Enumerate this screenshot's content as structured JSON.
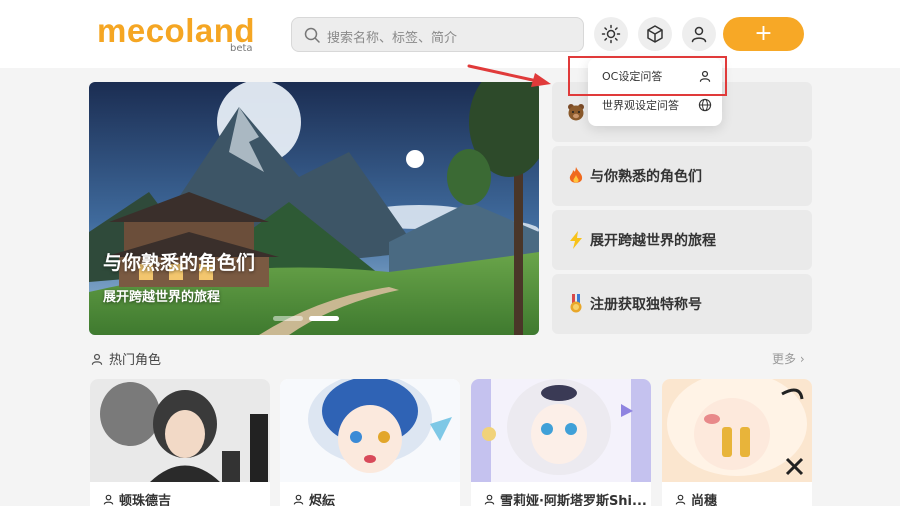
{
  "header": {
    "logo": "mecoland",
    "logo_badge": "beta",
    "search_placeholder": "搜索名称、标签、简介",
    "plus_label": "+"
  },
  "dropdown": {
    "items": [
      {
        "label": "OC设定问答",
        "icon": "user-icon"
      },
      {
        "label": "世界观设定问答",
        "icon": "globe-icon"
      }
    ]
  },
  "banner": {
    "title": "与你熟悉的角色们",
    "subtitle": "展开跨越世界的旅程",
    "slide_count": 2,
    "active_slide": 2
  },
  "cards": [
    {
      "label": "",
      "icon": "bear-icon"
    },
    {
      "label": "与你熟悉的角色们",
      "icon": "fire-icon"
    },
    {
      "label": "展开跨越世界的旅程",
      "icon": "lightning-icon"
    },
    {
      "label": "注册获取独特称号",
      "icon": "medal-icon"
    }
  ],
  "hot_characters": {
    "title": "热门角色",
    "more": "更多",
    "items": [
      {
        "name": "顿珠德吉"
      },
      {
        "name": "烬紜"
      },
      {
        "name": "雪莉娅·阿斯塔罗斯Shi..."
      },
      {
        "name": "尚穗"
      }
    ]
  },
  "colors": {
    "brand": "#f5a623",
    "highlight": "#e03a3a"
  }
}
